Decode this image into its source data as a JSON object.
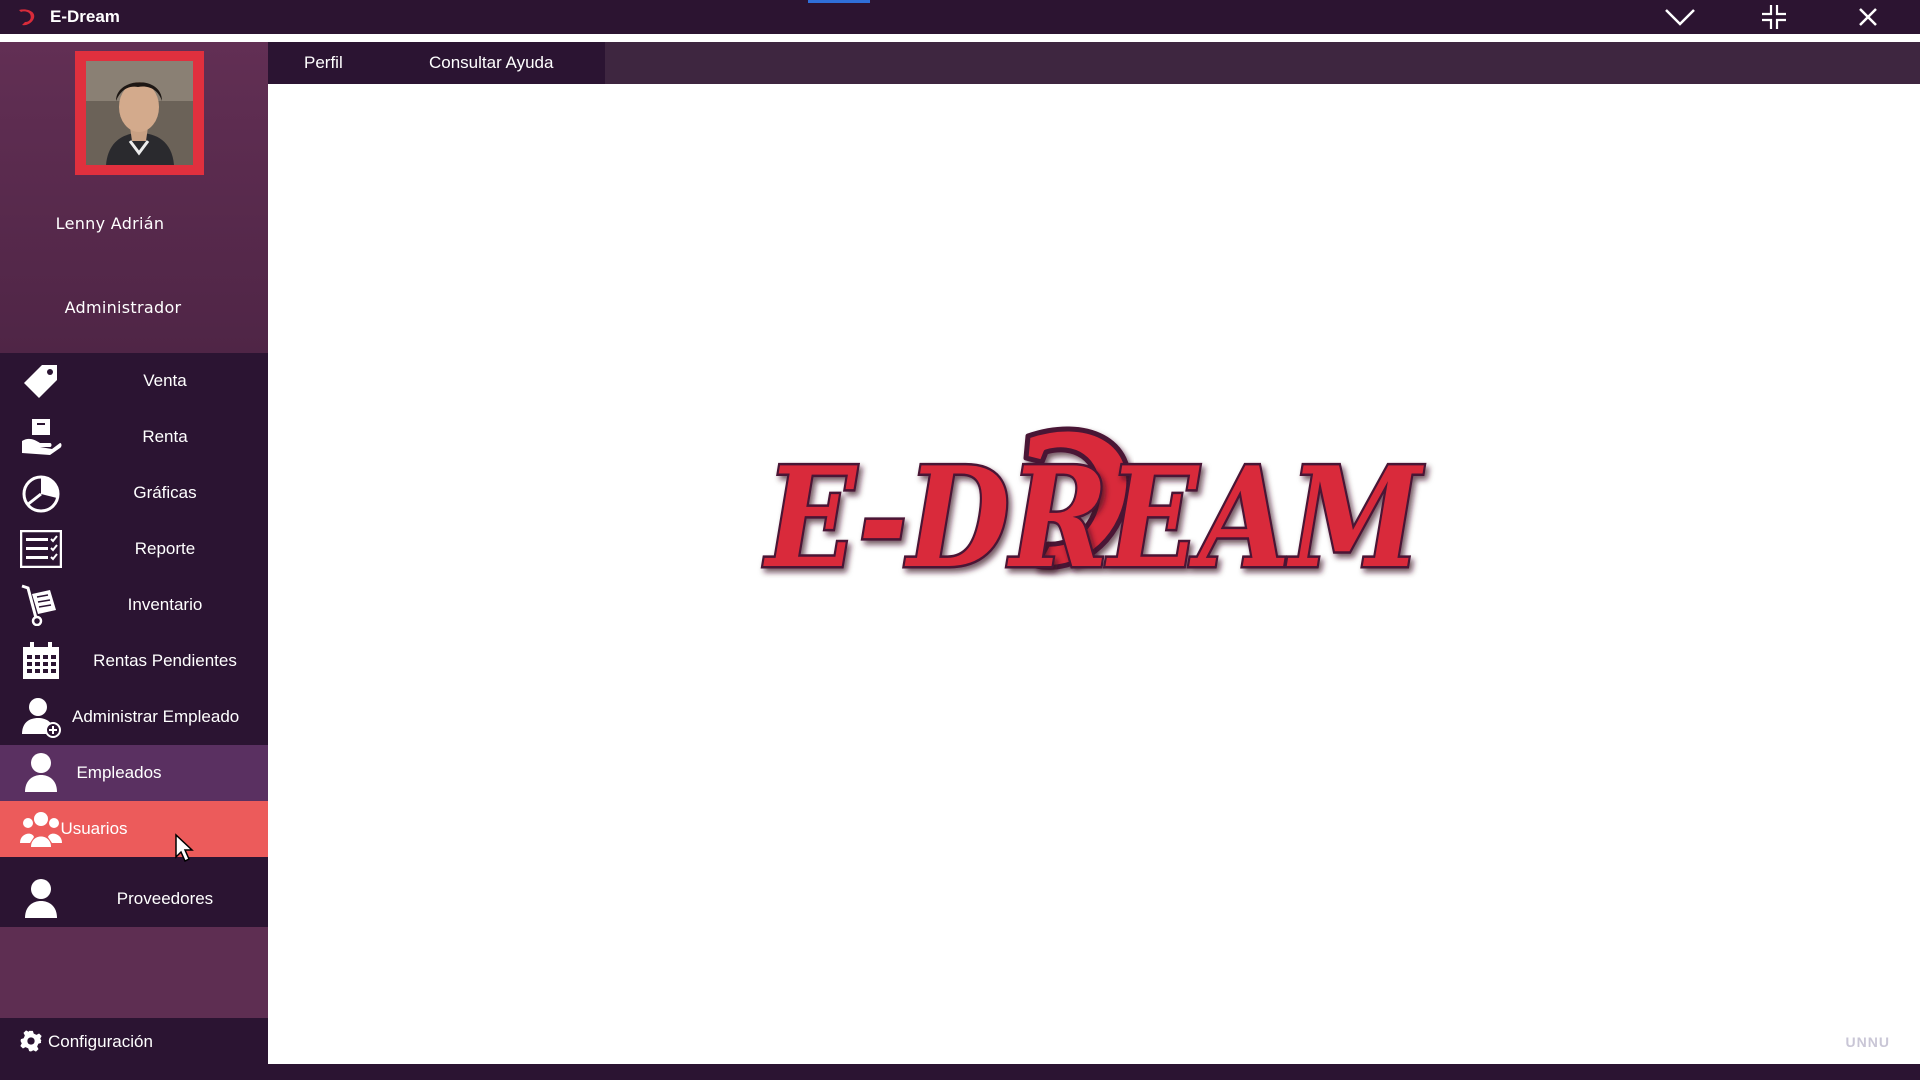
{
  "window": {
    "title": "E-Dream"
  },
  "profile": {
    "name": "Lenny Adrián",
    "role": "Administrador"
  },
  "sidebar": {
    "items": [
      {
        "label": "Venta",
        "icon": "price-tag-icon"
      },
      {
        "label": "Renta",
        "icon": "hand-box-icon"
      },
      {
        "label": "Gráficas",
        "icon": "pie-chart-icon"
      },
      {
        "label": "Reporte",
        "icon": "report-list-icon"
      },
      {
        "label": "Inventario",
        "icon": "hand-truck-icon"
      },
      {
        "label": "Rentas Pendientes",
        "icon": "calendar-icon"
      },
      {
        "label": "Administrar Empleado",
        "icon": "add-user-icon"
      },
      {
        "label": "Empleados",
        "icon": "user-icon"
      },
      {
        "label": "Usuarios",
        "icon": "users-group-icon"
      },
      {
        "label": "Proveedores",
        "icon": "user-icon"
      }
    ],
    "config_label": "Configuración"
  },
  "topnav": {
    "tabs": [
      {
        "label": "Perfil"
      },
      {
        "label": "Consultar Ayuda"
      }
    ]
  },
  "main": {
    "logo_text": "E-DREAM",
    "watermark": "UNNU"
  },
  "colors": {
    "titlebar": "#2c1431",
    "sidebar_profile": "#5e2e52",
    "menu_bg": "#2b1432",
    "hover_bg": "#5a3061",
    "active_bg": "#ec5b5b",
    "logo_red": "#d92b3a",
    "logo_outline": "#4a1234"
  }
}
